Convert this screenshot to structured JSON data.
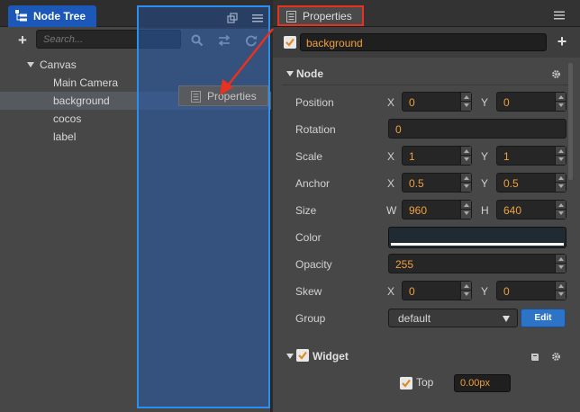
{
  "node_tree": {
    "tab_label": "Node Tree",
    "search_placeholder": "Search...",
    "items": [
      {
        "label": "Canvas"
      },
      {
        "label": "Main Camera"
      },
      {
        "label": "background"
      },
      {
        "label": "cocos"
      },
      {
        "label": "label"
      }
    ],
    "selected_item": "background"
  },
  "drag_ghost": {
    "label": "Properties"
  },
  "properties": {
    "tab_label": "Properties",
    "node_name": "background",
    "node_active": true,
    "node_section": {
      "title": "Node",
      "position": {
        "label": "Position",
        "x_axis": "X",
        "x": "0",
        "y_axis": "Y",
        "y": "0"
      },
      "rotation": {
        "label": "Rotation",
        "value": "0"
      },
      "scale": {
        "label": "Scale",
        "x_axis": "X",
        "x": "1",
        "y_axis": "Y",
        "y": "1"
      },
      "anchor": {
        "label": "Anchor",
        "x_axis": "X",
        "x": "0.5",
        "y_axis": "Y",
        "y": "0.5"
      },
      "size": {
        "label": "Size",
        "w_axis": "W",
        "w": "960",
        "h_axis": "H",
        "h": "640"
      },
      "color": {
        "label": "Color",
        "value": "#1f2a33"
      },
      "opacity": {
        "label": "Opacity",
        "value": "255"
      },
      "skew": {
        "label": "Skew",
        "x_axis": "X",
        "x": "0",
        "y_axis": "Y",
        "y": "0"
      },
      "group": {
        "label": "Group",
        "value": "default",
        "edit_label": "Edit"
      }
    },
    "widget_section": {
      "title": "Widget",
      "enabled": true,
      "top_label": "Top",
      "top_checked": true,
      "top_value": "0.00px"
    }
  },
  "colors": {
    "accent_blue": "#1b58b8",
    "highlight_red": "#e8321f",
    "value_orange": "#f0a040"
  }
}
